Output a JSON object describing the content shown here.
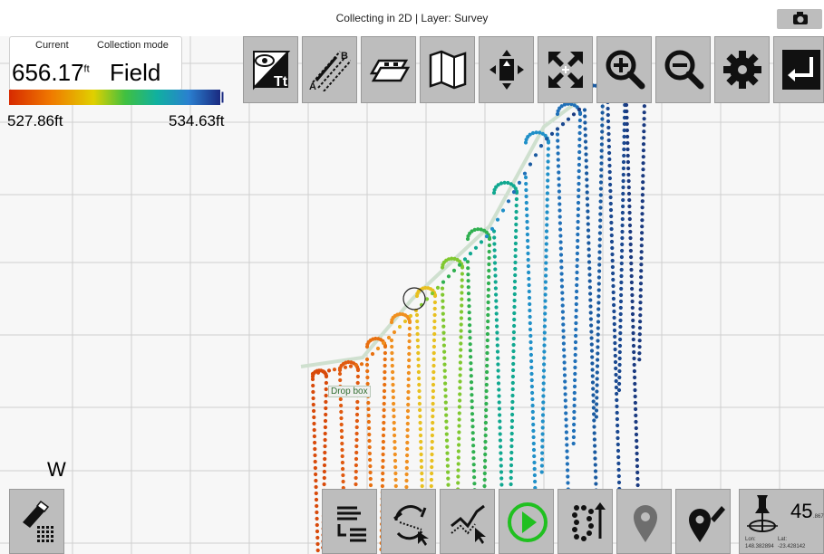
{
  "window": {
    "title": "Collecting in 2D | Layer: Survey"
  },
  "status": {
    "current_label": "Current",
    "current_value": "656.17",
    "current_unit": "ft",
    "mode_label": "Collection mode",
    "mode_value": "Field",
    "scale_min": "527.86ft",
    "scale_max": "534.63ft"
  },
  "compass": {
    "heading": "W"
  },
  "map": {
    "drop_box_label": "Drop box"
  },
  "gps": {
    "value": "45",
    "value_sub": ".867",
    "lon_label": "Lon:",
    "lat_label": "Lat:",
    "lon": "148.382894",
    "lat": "-23.428142"
  },
  "colors": {
    "accent_green": "#20c020",
    "button_bg": "#bdbdbd"
  },
  "toolbar_top": [
    {
      "icon": "view-text-icon"
    },
    {
      "icon": "ab-line-icon"
    },
    {
      "icon": "layers-icon"
    },
    {
      "icon": "map-icon"
    },
    {
      "icon": "pan-icon"
    },
    {
      "icon": "fit-extent-icon"
    },
    {
      "icon": "zoom-in-icon"
    },
    {
      "icon": "zoom-out-icon"
    },
    {
      "icon": "settings-gear-icon"
    },
    {
      "icon": "exit-icon"
    }
  ],
  "toolbar_bottom": [
    {
      "icon": "align-list-icon"
    },
    {
      "icon": "rotate-select-icon"
    },
    {
      "icon": "trace-select-icon"
    },
    {
      "icon": "play-icon"
    },
    {
      "icon": "route-add-icon"
    },
    {
      "icon": "marker-icon"
    },
    {
      "icon": "marker-edit-icon"
    },
    {
      "icon": "gps-pin-icon"
    }
  ]
}
